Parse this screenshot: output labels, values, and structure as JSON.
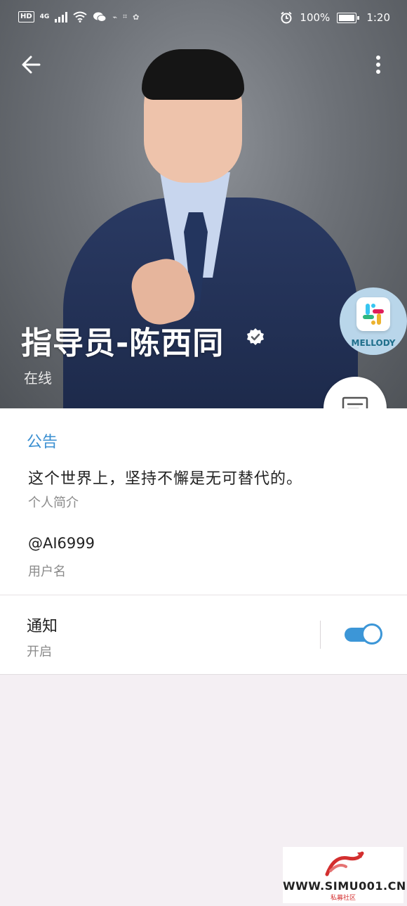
{
  "status_bar": {
    "hd": "HD",
    "network": "4G",
    "battery": "100%",
    "time": "1:20"
  },
  "profile": {
    "name": "指导员-陈西同",
    "status": "在线",
    "verified_icon": "verified-check-icon"
  },
  "app_badge": {
    "label": "MELLODY"
  },
  "announcement": {
    "title": "公告"
  },
  "bio": {
    "text": "这个世界上，坚持不懈是无可替代的。",
    "label": "个人简介"
  },
  "username": {
    "text": "@AI6999",
    "label": "用户名"
  },
  "notifications": {
    "title": "通知",
    "value": "开启",
    "enabled": true
  },
  "watermark": {
    "text": "WWW.SIMU001.CN",
    "sub": "私募社区"
  },
  "colors": {
    "accent": "#3a8fd1",
    "toggle": "#3c96d7"
  }
}
